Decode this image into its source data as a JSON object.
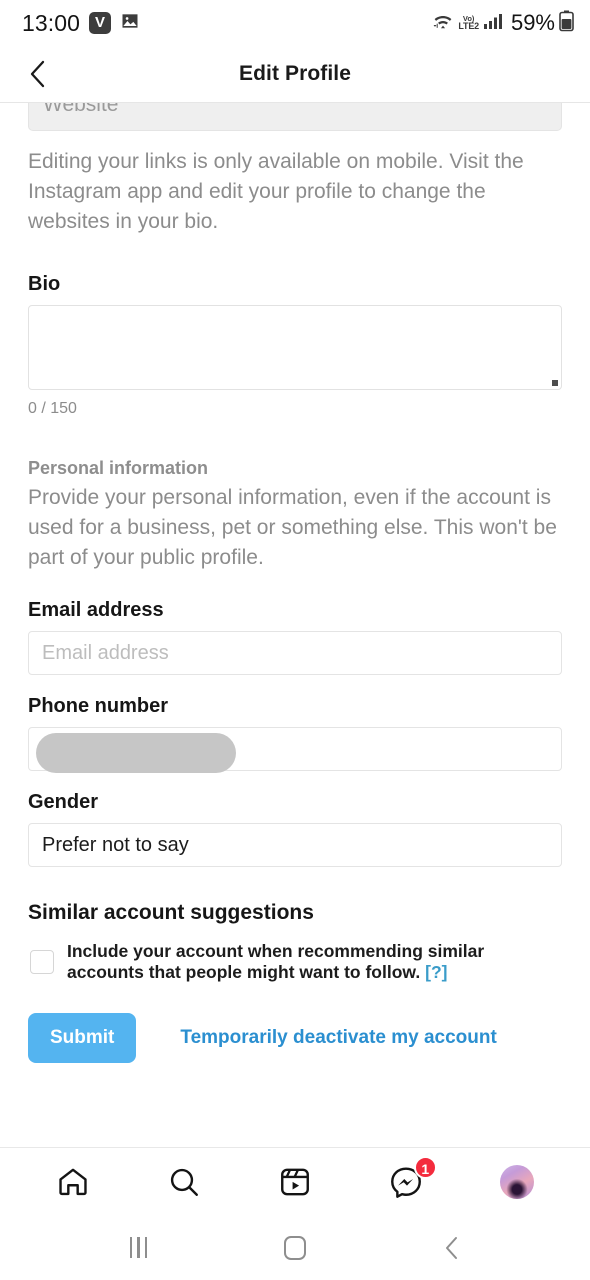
{
  "status_bar": {
    "time": "13:00",
    "v_badge": "V",
    "gallery_icon": "image-icon",
    "wifi_icon": "wifi-icon",
    "volte_top": "Vo)",
    "volte_bottom": "LTE2",
    "signal_icon": "signal-bars-icon",
    "battery_percent": "59%",
    "battery_icon": "battery-icon"
  },
  "header": {
    "back_icon": "back-chevron-icon",
    "title": "Edit Profile"
  },
  "form": {
    "website": {
      "placeholder": "Website",
      "helper": "Editing your links is only available on mobile. Visit the Instagram app and edit your profile to change the websites in your bio."
    },
    "bio": {
      "label": "Bio",
      "value": "",
      "char_count": "0 / 150"
    },
    "personal_information": {
      "heading": "Personal information",
      "description": "Provide your personal information, even if the account is used for a business, pet or something else. This won't be part of your public profile."
    },
    "email": {
      "label": "Email address",
      "placeholder": "Email address",
      "value": ""
    },
    "phone": {
      "label": "Phone number",
      "value": ""
    },
    "gender": {
      "label": "Gender",
      "value": "Prefer not to say"
    },
    "similar_accounts": {
      "heading": "Similar account suggestions",
      "checkbox_label": "Include your account when recommending similar accounts that people might want to follow.",
      "help_label": "[?]",
      "checked": false
    },
    "actions": {
      "submit_label": "Submit",
      "deactivate_label": "Temporarily deactivate my account"
    }
  },
  "bottom_nav": {
    "items": [
      {
        "name": "home",
        "icon": "home-icon"
      },
      {
        "name": "search",
        "icon": "search-icon"
      },
      {
        "name": "reels",
        "icon": "reels-icon"
      },
      {
        "name": "messenger",
        "icon": "messenger-icon",
        "badge": "1"
      },
      {
        "name": "profile",
        "icon": "avatar-icon"
      }
    ]
  },
  "android_nav": {
    "recents_icon": "recents-icon",
    "home_icon": "home-square-icon",
    "back_icon": "back-chevron-icon"
  },
  "colors": {
    "accent_blue": "#54b4f0",
    "link_blue": "#2b8fd0",
    "badge_red": "#f42b3d",
    "muted_gray": "#8c8c8c"
  }
}
